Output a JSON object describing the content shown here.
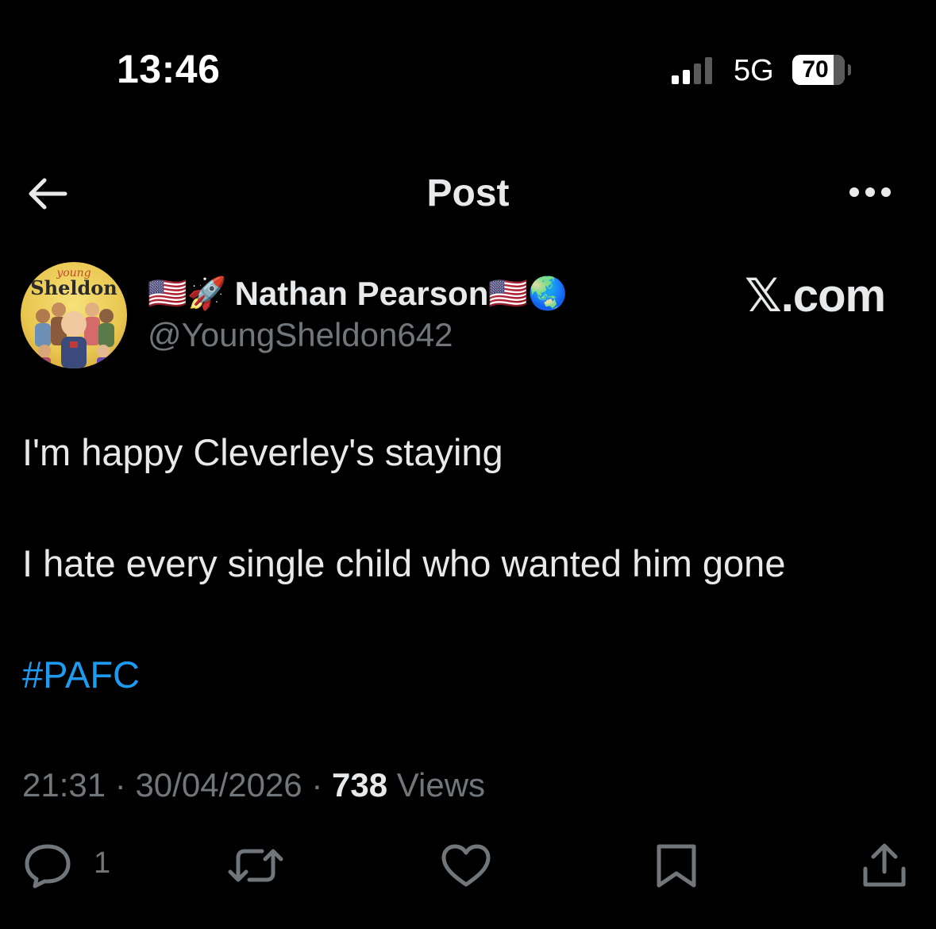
{
  "status_bar": {
    "time": "13:46",
    "network": "5G",
    "battery": "70"
  },
  "header": {
    "title": "Post",
    "back_icon": "arrow-left-icon",
    "more_icon": "more-dots-icon"
  },
  "author": {
    "avatar_text_top": "young",
    "avatar_text_main": "Sheldon",
    "name_prefix_emoji": "🇺🇸🚀",
    "name": "Nathan Pearson",
    "name_suffix_emoji": "🇺🇸🌏",
    "handle": "@YoungSheldon642"
  },
  "watermark": "𝕏.com",
  "post": {
    "line1": "I'm happy Cleverley's staying",
    "line2": "I hate every single child who wanted him gone",
    "hashtag": "#PAFC"
  },
  "meta": {
    "time": "21:31",
    "date": "30/04/2026",
    "separator": "·",
    "views_count": "738",
    "views_label": "Views"
  },
  "actions": {
    "reply_count": "1",
    "icons": [
      "reply-icon",
      "repost-icon",
      "like-icon",
      "bookmark-icon",
      "share-icon"
    ]
  },
  "colors": {
    "background": "#000000",
    "text_primary": "#e7e9ea",
    "text_secondary": "#71767b",
    "link": "#1d9bf0"
  }
}
